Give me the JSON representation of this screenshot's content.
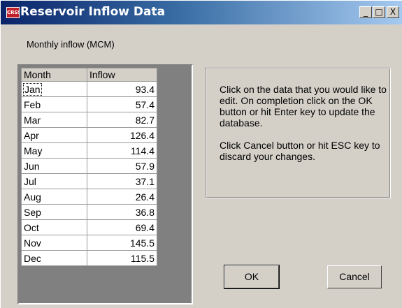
{
  "window": {
    "title": "Reservoir Inflow Data",
    "icon_label": "CRSS",
    "controls": {
      "minimize": "_",
      "maximize": "□",
      "close": "X"
    }
  },
  "caption": "Monthly inflow (MCM)",
  "grid": {
    "columns": [
      "Month",
      "Inflow"
    ],
    "rows": [
      {
        "month": "Jan",
        "inflow": "93.4"
      },
      {
        "month": "Feb",
        "inflow": "57.4"
      },
      {
        "month": "Mar",
        "inflow": "82.7"
      },
      {
        "month": "Apr",
        "inflow": "126.4"
      },
      {
        "month": "May",
        "inflow": "114.4"
      },
      {
        "month": "Jun",
        "inflow": "57.9"
      },
      {
        "month": "Jul",
        "inflow": "37.1"
      },
      {
        "month": "Aug",
        "inflow": "26.4"
      },
      {
        "month": "Sep",
        "inflow": "36.8"
      },
      {
        "month": "Oct",
        "inflow": "69.4"
      },
      {
        "month": "Nov",
        "inflow": "145.5"
      },
      {
        "month": "Dec",
        "inflow": "115.5"
      }
    ],
    "selected_row": 0
  },
  "instructions": {
    "paragraph1": "Click on the data that you would like to edit. On completion click on the OK button or hit Enter key to update the database.",
    "paragraph2": "Click Cancel button or hit ESC key to discard your changes."
  },
  "buttons": {
    "ok": "OK",
    "cancel": "Cancel"
  },
  "colors": {
    "title_bar_start": "#0a246a",
    "title_bar_end": "#a6caf0",
    "face": "#d4d0c8",
    "icon_red": "#c0202a"
  }
}
